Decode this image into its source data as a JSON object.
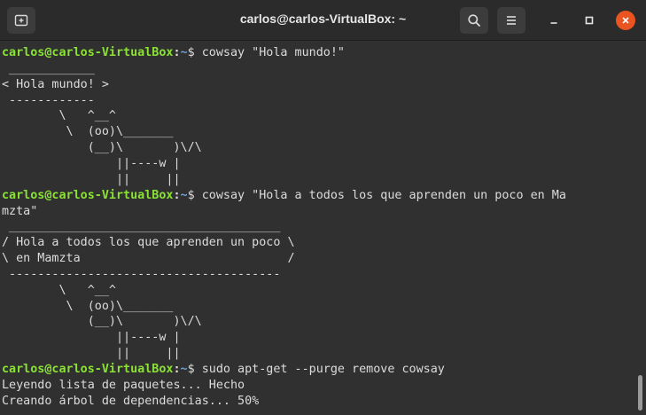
{
  "window": {
    "title": "carlos@carlos-VirtualBox: ~"
  },
  "titlebar_icons": {
    "new_tab": "new-tab-icon",
    "search": "search-icon",
    "menu": "hamburger-menu-icon",
    "minimize": "minimize-icon",
    "maximize": "maximize-icon",
    "close": "close-icon"
  },
  "colors": {
    "prompt_user": "#8ae234",
    "prompt_path": "#729fcf",
    "close_button": "#e95420",
    "terminal_bg": "#303030"
  },
  "terminal": {
    "prompt": {
      "user_host": "carlos@carlos-VirtualBox",
      "colon": ":",
      "path": "~",
      "symbol": "$"
    },
    "lines": [
      {
        "type": "prompt",
        "command": " cowsay \"Hola mundo!\""
      },
      {
        "type": "out",
        "text": " ____________"
      },
      {
        "type": "out",
        "text": "< Hola mundo! >"
      },
      {
        "type": "out",
        "text": " ------------"
      },
      {
        "type": "out",
        "text": "        \\   ^__^"
      },
      {
        "type": "out",
        "text": "         \\  (oo)\\_______"
      },
      {
        "type": "out",
        "text": "            (__)\\       )\\/\\"
      },
      {
        "type": "out",
        "text": "                ||----w |"
      },
      {
        "type": "out",
        "text": "                ||     ||"
      },
      {
        "type": "prompt",
        "command": " cowsay \"Hola a todos los que aprenden un poco en Ma"
      },
      {
        "type": "out",
        "text": "mzta\""
      },
      {
        "type": "out",
        "text": " ______________________________________"
      },
      {
        "type": "out",
        "text": "/ Hola a todos los que aprenden un poco \\"
      },
      {
        "type": "out",
        "text": "\\ en Mamzta                             /"
      },
      {
        "type": "out",
        "text": " --------------------------------------"
      },
      {
        "type": "out",
        "text": "        \\   ^__^"
      },
      {
        "type": "out",
        "text": "         \\  (oo)\\_______"
      },
      {
        "type": "out",
        "text": "            (__)\\       )\\/\\"
      },
      {
        "type": "out",
        "text": "                ||----w |"
      },
      {
        "type": "out",
        "text": "                ||     ||"
      },
      {
        "type": "prompt",
        "command": " sudo apt-get --purge remove cowsay"
      },
      {
        "type": "out",
        "text": "Leyendo lista de paquetes... Hecho"
      },
      {
        "type": "out",
        "text": "Creando árbol de dependencias... 50%"
      }
    ]
  }
}
